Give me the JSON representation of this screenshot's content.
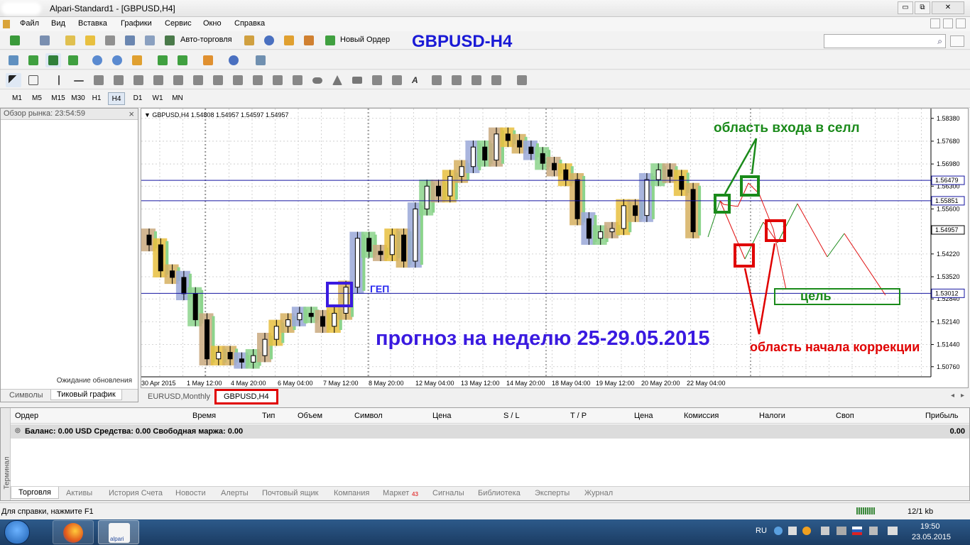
{
  "window": {
    "title": "Alpari-Standard1 - [GBPUSD,H4]",
    "minimize": "▭",
    "restore": "⧉",
    "close": "✕"
  },
  "menu": [
    "Файл",
    "Вид",
    "Вставка",
    "Графики",
    "Сервис",
    "Окно",
    "Справка"
  ],
  "toolbar": {
    "autotrade_label": "Авто-торговля",
    "new_order_label": "Новый Ордер"
  },
  "timeframes": [
    "M1",
    "M5",
    "M15",
    "M30",
    "H1",
    "H4",
    "D1",
    "W1",
    "MN"
  ],
  "active_timeframe": "H4",
  "overlay_title": "GBPUSD-H4",
  "market_watch": {
    "header": "Обзор рынка: 23:54:59",
    "close": "×",
    "waiting": "Ожидание обновления",
    "tabs": [
      "Символы",
      "Тиковый график"
    ]
  },
  "chart": {
    "info": "GBPUSD,H4  1.54808 1.54957 1.54597 1.54957",
    "tabs": [
      "EURUSD,Monthly",
      "GBPUSD,H4"
    ],
    "annotations": {
      "entry": "область входа в селл",
      "gap": "ГЕП",
      "target": "цель",
      "forecast": "прогноз на неделю 25-29.05.2015",
      "correction": "область начала коррекции"
    }
  },
  "chart_data": {
    "type": "candlestick",
    "symbol": "GBPUSD",
    "timeframe": "H4",
    "y_ticks": [
      "1.58380",
      "1.57680",
      "1.56980",
      "1.56300",
      "1.55600",
      "1.54220",
      "1.53520",
      "1.52840",
      "1.52140",
      "1.51440",
      "1.50760"
    ],
    "price_labels": [
      {
        "value": 1.56479,
        "text": "1.56479",
        "color": "#1515a0"
      },
      {
        "value": 1.55851,
        "text": "1.55851",
        "color": "#1515a0"
      },
      {
        "value": 1.54957,
        "text": "1.54957",
        "color": "#000000"
      },
      {
        "value": 1.53012,
        "text": "1.53012",
        "color": "#1515a0"
      }
    ],
    "x_labels": [
      "30 Apr 2015",
      "1 May 12:00",
      "4 May 20:00",
      "6 May 04:00",
      "7 May 12:00",
      "8 May 20:00",
      "12 May 04:00",
      "13 May 12:00",
      "14 May 20:00",
      "18 May 04:00",
      "19 May 12:00",
      "20 May 20:00",
      "22 May 04:00"
    ],
    "ylim": [
      1.5045,
      1.5868
    ],
    "series": [
      {
        "name": "close",
        "values": [
          1.545,
          1.537,
          1.535,
          1.53,
          1.522,
          1.51,
          1.512,
          1.51,
          1.509,
          1.511,
          1.516,
          1.52,
          1.522,
          1.524,
          1.523,
          1.52,
          1.524,
          1.532,
          1.547,
          1.543,
          1.542,
          1.548,
          1.54,
          1.556,
          1.563,
          1.56,
          1.566,
          1.569,
          1.575,
          1.571,
          1.579,
          1.577,
          1.575,
          1.573,
          1.57,
          1.568,
          1.565,
          1.553,
          1.547,
          1.549,
          1.55,
          1.557,
          1.554,
          1.565,
          1.568,
          1.566,
          1.562,
          1.549
        ]
      }
    ]
  },
  "terminal": {
    "columns": [
      "Ордер",
      "Время",
      "Тип",
      "Объем",
      "Символ",
      "Цена",
      "S / L",
      "T / P",
      "Цена",
      "Комиссия",
      "Налоги",
      "Своп",
      "Прибыль"
    ],
    "balance_row": "Баланс: 0.00 USD  Средства: 0.00  Свободная маржа: 0.00",
    "balance_profit": "0.00",
    "side_label": "Терминал",
    "tabs": [
      "Торговля",
      "Активы",
      "История Счета",
      "Новости",
      "Алерты",
      "Почтовый ящик",
      "Компания",
      "Маркет",
      "Сигналы",
      "Библиотека",
      "Эксперты",
      "Журнал"
    ],
    "market_badge": "43"
  },
  "status": {
    "help": "Для справки, нажмите F1",
    "traffic": "12/1 kb"
  },
  "taskbar": {
    "lang": "RU",
    "time": "19:50",
    "date": "23.05.2015",
    "alpari_label": "alpari"
  }
}
